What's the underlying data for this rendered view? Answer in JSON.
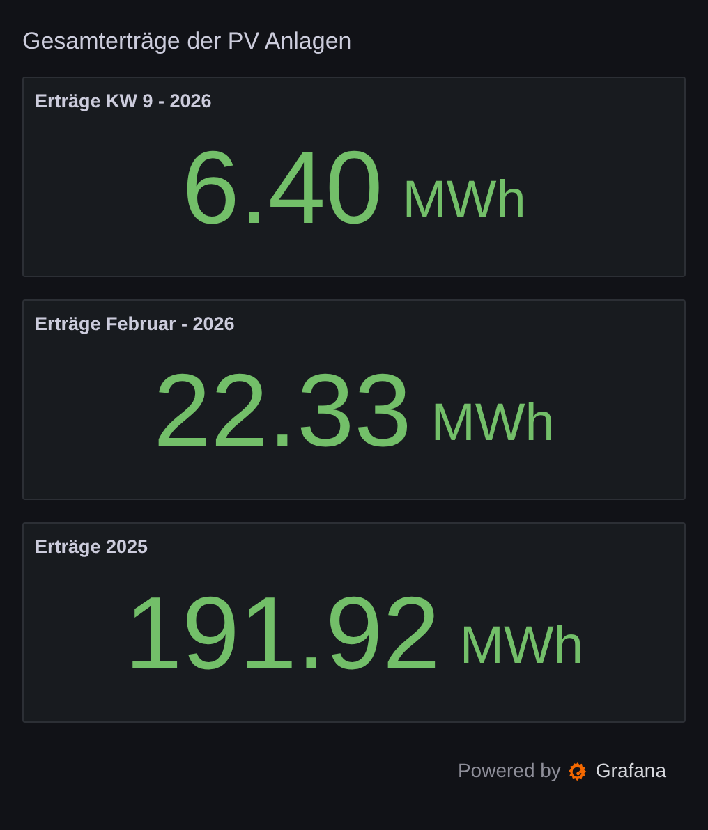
{
  "dashboard": {
    "title": "Gesamterträge der PV Anlagen"
  },
  "panels": [
    {
      "title": "Erträge KW 9 - 2026",
      "value": "6.40",
      "unit": "MWh"
    },
    {
      "title": "Erträge Februar - 2026",
      "value": "22.33",
      "unit": "MWh"
    },
    {
      "title": "Erträge 2025",
      "value": "191.92",
      "unit": "MWh"
    }
  ],
  "footer": {
    "powered_by": "Powered by",
    "brand": "Grafana"
  }
}
